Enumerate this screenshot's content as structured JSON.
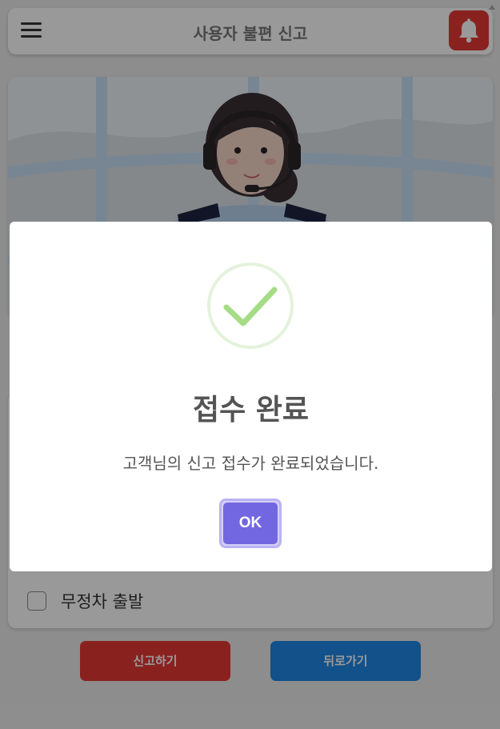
{
  "header": {
    "title": "사용자 불편 신고",
    "menu_icon": "hamburger-menu-icon",
    "bell_icon": "bell-icon",
    "bell_color": "#e53935"
  },
  "hero": {
    "image": "operator-headset-illustration"
  },
  "options": [
    {
      "label": "무정차 출발",
      "checked": false
    }
  ],
  "actions": {
    "report_label": "신고하기",
    "back_label": "뒤로가기",
    "report_color": "#e53935",
    "back_color": "#1e88e5"
  },
  "modal": {
    "icon": "success-check-icon",
    "title": "접수 완료",
    "message": "고객님의 신고 접수가 완료되었습니다.",
    "ok_label": "OK",
    "ok_color": "#7367e1",
    "success_color": "#a5dc86"
  }
}
